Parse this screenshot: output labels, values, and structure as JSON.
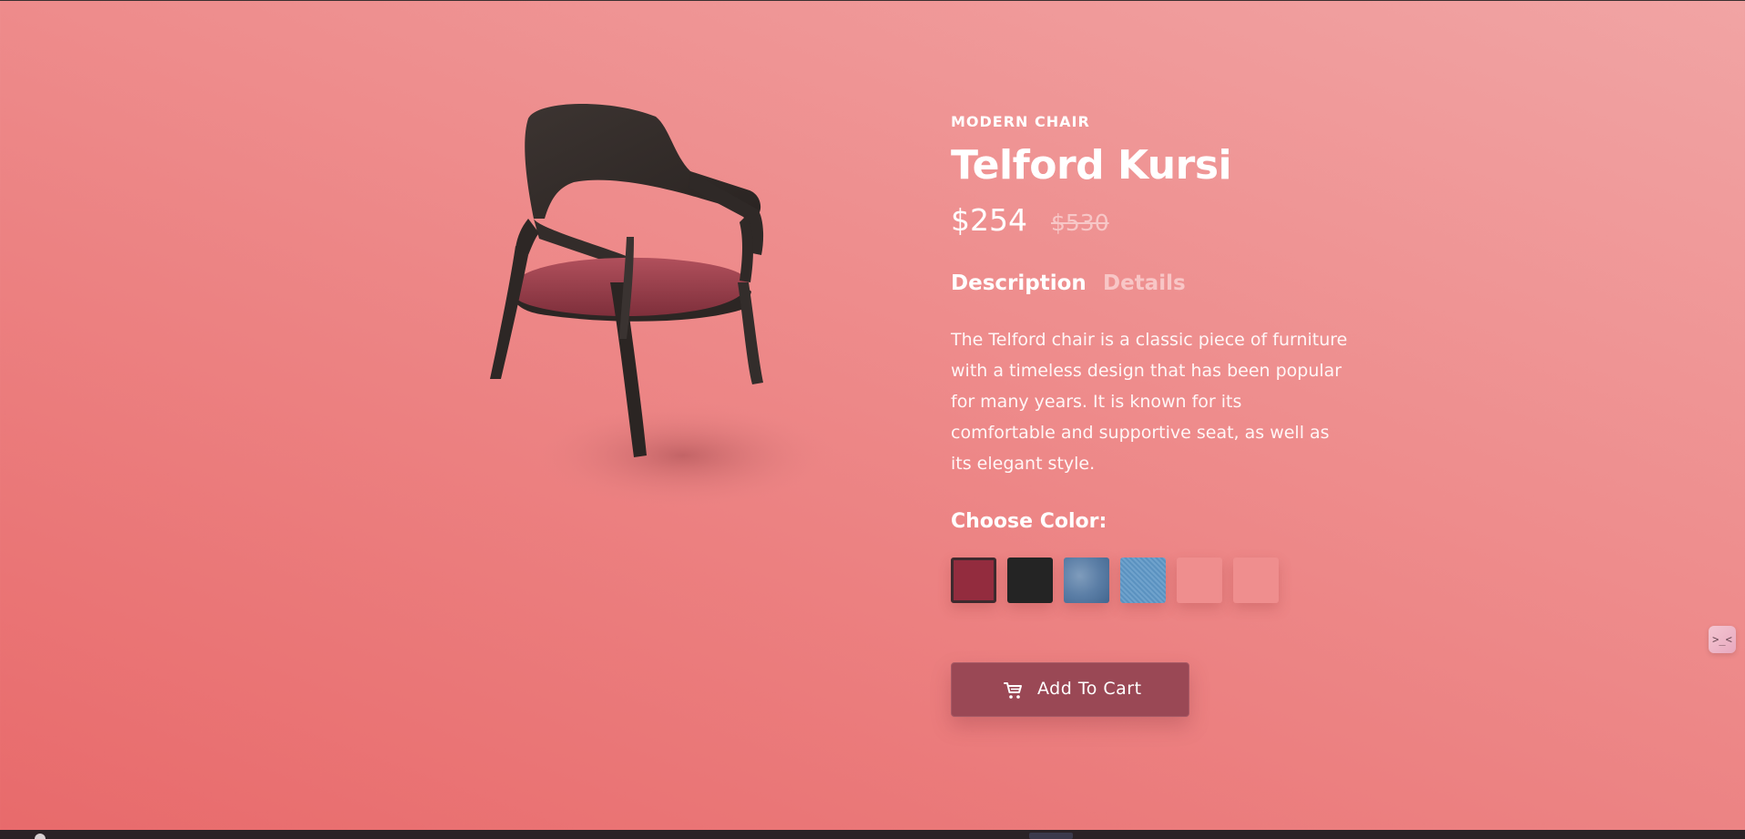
{
  "product": {
    "category": "MODERN CHAIR",
    "title": "Telford Kursi",
    "price": "$254",
    "old_price": "$530"
  },
  "tabs": [
    {
      "label": "Description",
      "active": true
    },
    {
      "label": "Details",
      "active": false
    }
  ],
  "description": "The Telford chair is a classic piece of furniture with a timeless design that has been popular for many years. It is known for its comfortable and supportive seat, as well as its elegant style.",
  "color_picker": {
    "label": "Choose Color:",
    "swatches": [
      {
        "name": "crimson-fabric",
        "color": "#932c3e",
        "selected": true
      },
      {
        "name": "black",
        "color": "#242424",
        "selected": false
      },
      {
        "name": "blue-velvet",
        "color": "#5b7ea6",
        "selected": false
      },
      {
        "name": "light-blue-denim",
        "color": "#6fa2cc",
        "selected": false
      },
      {
        "name": "pink",
        "color": "#ef8e8e",
        "selected": false
      },
      {
        "name": "pink-2",
        "color": "#ef8e8e",
        "selected": false
      }
    ]
  },
  "cart_button": {
    "label": "Add To Cart",
    "icon": "cart-icon"
  },
  "colors": {
    "accent": "#9a4855",
    "background_top": "#f1a4a4",
    "background_bottom": "#e86a6b"
  },
  "side_widget": {
    "icon": "widget-face-icon"
  }
}
